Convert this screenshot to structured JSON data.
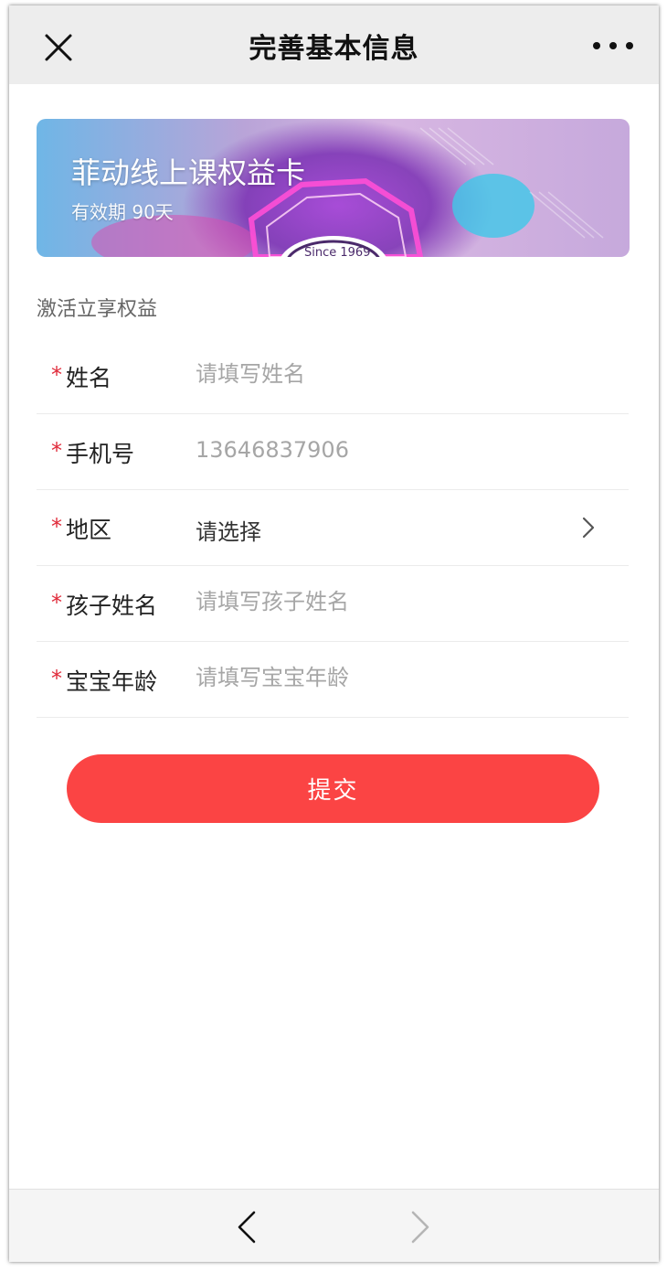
{
  "navbar": {
    "title": "完善基本信息",
    "close_icon": "close-icon",
    "more_icon": "more-dots-icon"
  },
  "banner": {
    "title": "菲动线上课权益卡",
    "subtitle": "有效期 90天",
    "badge_text": "Since 1969"
  },
  "form": {
    "section_label": "激活立享权益",
    "required_mark": "*",
    "fields": [
      {
        "label": "姓名",
        "placeholder": "请填写姓名",
        "value": ""
      },
      {
        "label": "手机号",
        "placeholder": "",
        "value": "13646837906"
      },
      {
        "label": "地区",
        "value": "请选择"
      },
      {
        "label": "孩子姓名",
        "placeholder": "请填写孩子姓名",
        "value": ""
      },
      {
        "label": "宝宝年龄",
        "placeholder": "请填写宝宝年龄",
        "value": ""
      }
    ]
  },
  "submit_label": "提交",
  "colors": {
    "accent": "#fb4444",
    "required": "#e02a3a",
    "navbar_bg": "#ededed"
  }
}
